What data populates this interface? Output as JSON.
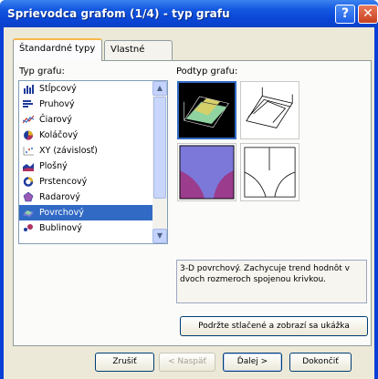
{
  "window": {
    "title": "Sprievodca grafom (1/4) - typ grafu",
    "help_label": "?",
    "close_label": "✕"
  },
  "tabs": [
    {
      "label": "Štandardné typy",
      "active": true
    },
    {
      "label": "Vlastné typy",
      "active": false
    }
  ],
  "chart_type_section": {
    "label": "Typ grafu:",
    "items": [
      {
        "label": "Stĺpcový",
        "icon": "column-chart-icon"
      },
      {
        "label": "Pruhový",
        "icon": "bar-chart-icon"
      },
      {
        "label": "Čiarový",
        "icon": "line-chart-icon"
      },
      {
        "label": "Koláčový",
        "icon": "pie-chart-icon"
      },
      {
        "label": "XY (závislosť)",
        "icon": "scatter-chart-icon"
      },
      {
        "label": "Plošný",
        "icon": "area-chart-icon"
      },
      {
        "label": "Prstencový",
        "icon": "doughnut-chart-icon"
      },
      {
        "label": "Radarový",
        "icon": "radar-chart-icon"
      },
      {
        "label": "Povrchový",
        "icon": "surface-chart-icon",
        "selected": true
      },
      {
        "label": "Bublinový",
        "icon": "bubble-chart-icon"
      }
    ]
  },
  "subtype_section": {
    "label": "Podtyp grafu:",
    "selected_index": 0
  },
  "description": "3-D povrchový. Zachycuje trend hodnôt v dvoch rozmeroch spojenou krivkou.",
  "press_button_label": "Podržte stlačené a zobrazí sa ukážka",
  "buttons": {
    "cancel": "Zrušiť",
    "back": "< Naspäť",
    "next": "Ďalej >",
    "finish": "Dokončiť"
  },
  "colors": {
    "selection": "#316ac5",
    "surface_green": "#8fd3a0",
    "surface_yellow": "#d6d06a",
    "surface_purple": "#9b3c8c",
    "surface_blue": "#7c78d9"
  }
}
